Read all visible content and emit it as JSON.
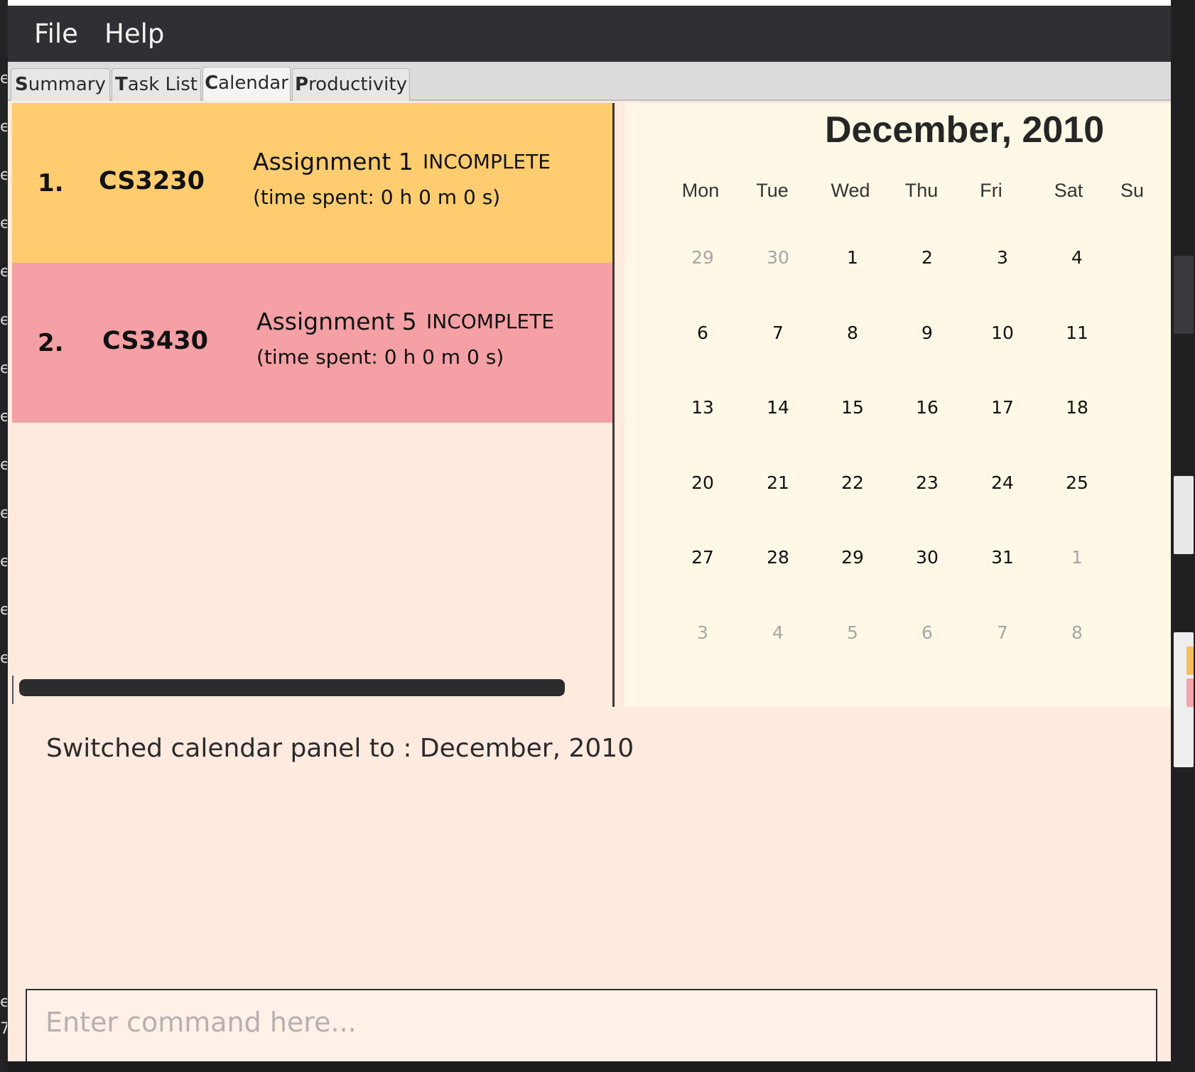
{
  "menu": {
    "file": "File",
    "help": "Help"
  },
  "tabs": [
    {
      "mnemonic": "S",
      "rest": "ummary"
    },
    {
      "mnemonic": "T",
      "rest": "ask List"
    },
    {
      "mnemonic": "C",
      "rest": "alendar"
    },
    {
      "mnemonic": "P",
      "rest": "roductivity"
    }
  ],
  "selected_tab": "Calendar",
  "tasks": [
    {
      "index": "1.",
      "module": "CS3230",
      "name": "Assignment 1",
      "status": "INCOMPLETE",
      "time": "(time spent: 0 h 0 m 0 s)",
      "color": "#ffcc70"
    },
    {
      "index": "2.",
      "module": "CS3430",
      "name": "Assignment 5",
      "status": "INCOMPLETE",
      "time": "(time spent: 0 h 0 m 0 s)",
      "color": "#f4a0a5"
    }
  ],
  "calendar": {
    "title": "December, 2010",
    "weekdays": [
      "Mon",
      "Tue",
      "Wed",
      "Thu",
      "Fri",
      "Sat",
      "Su"
    ],
    "weeks": [
      [
        "29",
        "30",
        "1",
        "2",
        "3",
        "4"
      ],
      [
        "6",
        "7",
        "8",
        "9",
        "10",
        "11"
      ],
      [
        "13",
        "14",
        "15",
        "16",
        "17",
        "18"
      ],
      [
        "20",
        "21",
        "22",
        "23",
        "24",
        "25"
      ],
      [
        "27",
        "28",
        "29",
        "30",
        "31",
        "1"
      ],
      [
        "3",
        "4",
        "5",
        "6",
        "7",
        "8"
      ]
    ],
    "other_month_color": "#a6a6a6"
  },
  "result": {
    "text": "Switched calendar panel to : December, 2010"
  },
  "command": {
    "placeholder": "Enter command here..."
  }
}
